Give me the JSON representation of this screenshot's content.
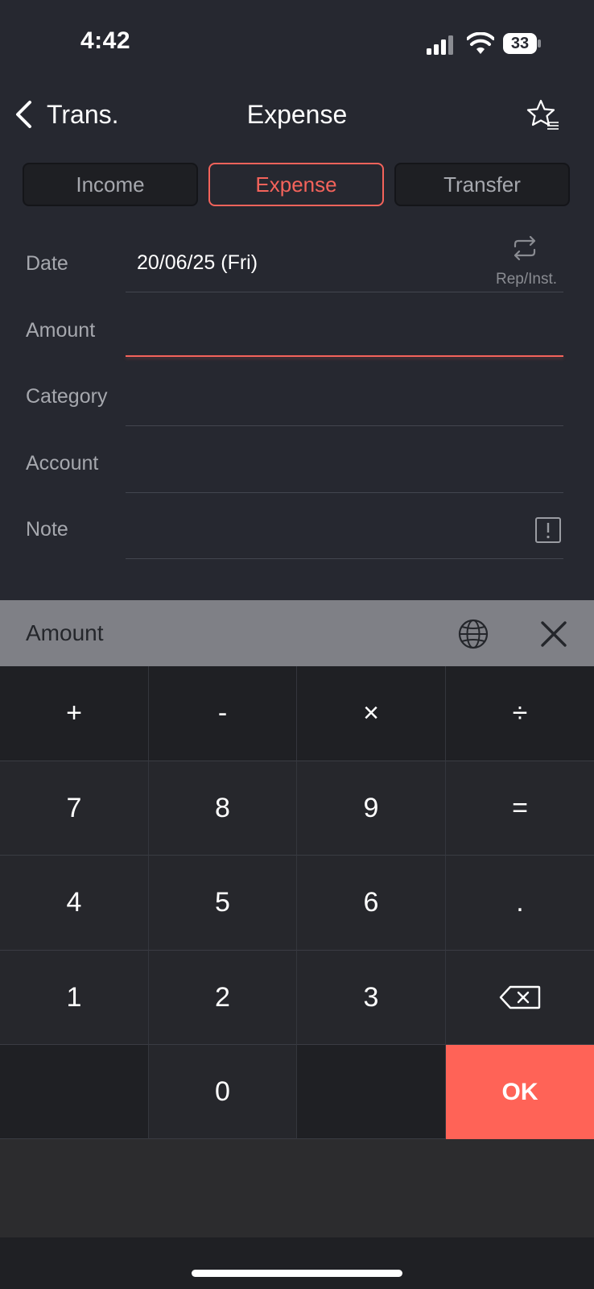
{
  "status_bar": {
    "time": "4:42",
    "battery": "33"
  },
  "nav": {
    "back_label": "Trans.",
    "title": "Expense"
  },
  "tabs": [
    {
      "label": "Income",
      "active": false
    },
    {
      "label": "Expense",
      "active": true
    },
    {
      "label": "Transfer",
      "active": false
    }
  ],
  "form": {
    "date_label": "Date",
    "date_value": "20/06/25 (Fri)",
    "repeat_label": "Rep/Inst.",
    "amount_label": "Amount",
    "amount_value": "",
    "category_label": "Category",
    "category_value": "",
    "account_label": "Account",
    "account_value": "",
    "note_label": "Note",
    "note_value": ""
  },
  "calculator": {
    "title": "Amount",
    "rows": [
      [
        "+",
        "-",
        "×",
        "÷"
      ],
      [
        "7",
        "8",
        "9",
        "="
      ],
      [
        "4",
        "5",
        "6",
        "."
      ],
      [
        "1",
        "2",
        "3",
        ""
      ],
      [
        "",
        "0",
        "",
        "OK"
      ]
    ]
  },
  "colors": {
    "accent": "#f4635b",
    "ok_button": "#ff6357",
    "background": "#262830"
  }
}
